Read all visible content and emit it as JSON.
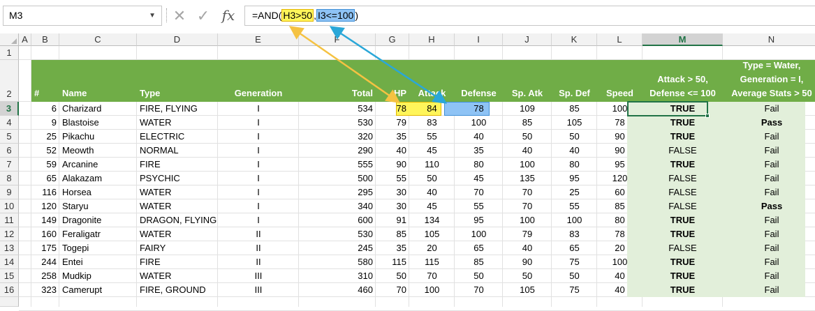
{
  "formula_bar": {
    "name_box": "M3",
    "formula_prefix": "=AND(",
    "ref1": "H3>50",
    "comma": ",",
    "ref2": "I3<=100",
    "formula_suffix": ")"
  },
  "column_letters": [
    "A",
    "B",
    "C",
    "D",
    "E",
    "F",
    "G",
    "H",
    "I",
    "J",
    "K",
    "L",
    "M",
    "N"
  ],
  "row_numbers": [
    "1",
    "2",
    "3",
    "4",
    "5",
    "6",
    "7",
    "8",
    "9",
    "10",
    "11",
    "12",
    "13",
    "14",
    "15",
    "16"
  ],
  "headers": {
    "num": "#",
    "name": "Name",
    "type": "Type",
    "generation": "Generation",
    "total": "Total",
    "hp": "HP",
    "attack": "Attack",
    "defense": "Defense",
    "sp_atk": "Sp. Atk",
    "sp_def": "Sp. Def",
    "speed": "Speed",
    "check1": [
      "Attack > 50,",
      "Defense <= 100"
    ],
    "check2": [
      "Type = Water,",
      "Generation = I,",
      "Average Stats > 50"
    ]
  },
  "rows": [
    [
      "6",
      "Charizard",
      "FIRE, FLYING",
      "I",
      "534",
      "78",
      "84",
      "78",
      "109",
      "85",
      "100",
      "TRUE",
      "Fail"
    ],
    [
      "9",
      "Blastoise",
      "WATER",
      "I",
      "530",
      "79",
      "83",
      "100",
      "85",
      "105",
      "78",
      "TRUE",
      "Pass"
    ],
    [
      "25",
      "Pikachu",
      "ELECTRIC",
      "I",
      "320",
      "35",
      "55",
      "40",
      "50",
      "50",
      "90",
      "TRUE",
      "Fail"
    ],
    [
      "52",
      "Meowth",
      "NORMAL",
      "I",
      "290",
      "40",
      "45",
      "35",
      "40",
      "40",
      "90",
      "FALSE",
      "Fail"
    ],
    [
      "59",
      "Arcanine",
      "FIRE",
      "I",
      "555",
      "90",
      "110",
      "80",
      "100",
      "80",
      "95",
      "TRUE",
      "Fail"
    ],
    [
      "65",
      "Alakazam",
      "PSYCHIC",
      "I",
      "500",
      "55",
      "50",
      "45",
      "135",
      "95",
      "120",
      "FALSE",
      "Fail"
    ],
    [
      "116",
      "Horsea",
      "WATER",
      "I",
      "295",
      "30",
      "40",
      "70",
      "70",
      "25",
      "60",
      "FALSE",
      "Fail"
    ],
    [
      "120",
      "Staryu",
      "WATER",
      "I",
      "340",
      "30",
      "45",
      "55",
      "70",
      "55",
      "85",
      "FALSE",
      "Pass"
    ],
    [
      "149",
      "Dragonite",
      "DRAGON, FLYING",
      "I",
      "600",
      "91",
      "134",
      "95",
      "100",
      "100",
      "80",
      "TRUE",
      "Fail"
    ],
    [
      "160",
      "Feraligatr",
      "WATER",
      "II",
      "530",
      "85",
      "105",
      "100",
      "79",
      "83",
      "78",
      "TRUE",
      "Fail"
    ],
    [
      "175",
      "Togepi",
      "FAIRY",
      "II",
      "245",
      "35",
      "20",
      "65",
      "40",
      "65",
      "20",
      "FALSE",
      "Fail"
    ],
    [
      "244",
      "Entei",
      "FIRE",
      "II",
      "580",
      "115",
      "115",
      "85",
      "90",
      "75",
      "100",
      "TRUE",
      "Fail"
    ],
    [
      "258",
      "Mudkip",
      "WATER",
      "III",
      "310",
      "50",
      "70",
      "50",
      "50",
      "50",
      "40",
      "TRUE",
      "Fail"
    ],
    [
      "323",
      "Camerupt",
      "FIRE, GROUND",
      "III",
      "460",
      "70",
      "100",
      "70",
      "105",
      "75",
      "40",
      "TRUE",
      "Fail"
    ]
  ],
  "colors": {
    "header_green": "#70ad47",
    "result_band": "#e2efda",
    "ref_yellow": "#fff55a",
    "ref_blue": "#8ec3f5",
    "arrow_yellow": "#f5c242",
    "arrow_blue": "#2aa7d8",
    "selection_green": "#217346"
  },
  "icons": {
    "cancel": "close-x-icon",
    "enter": "checkmark-icon",
    "function": "fx-icon"
  }
}
